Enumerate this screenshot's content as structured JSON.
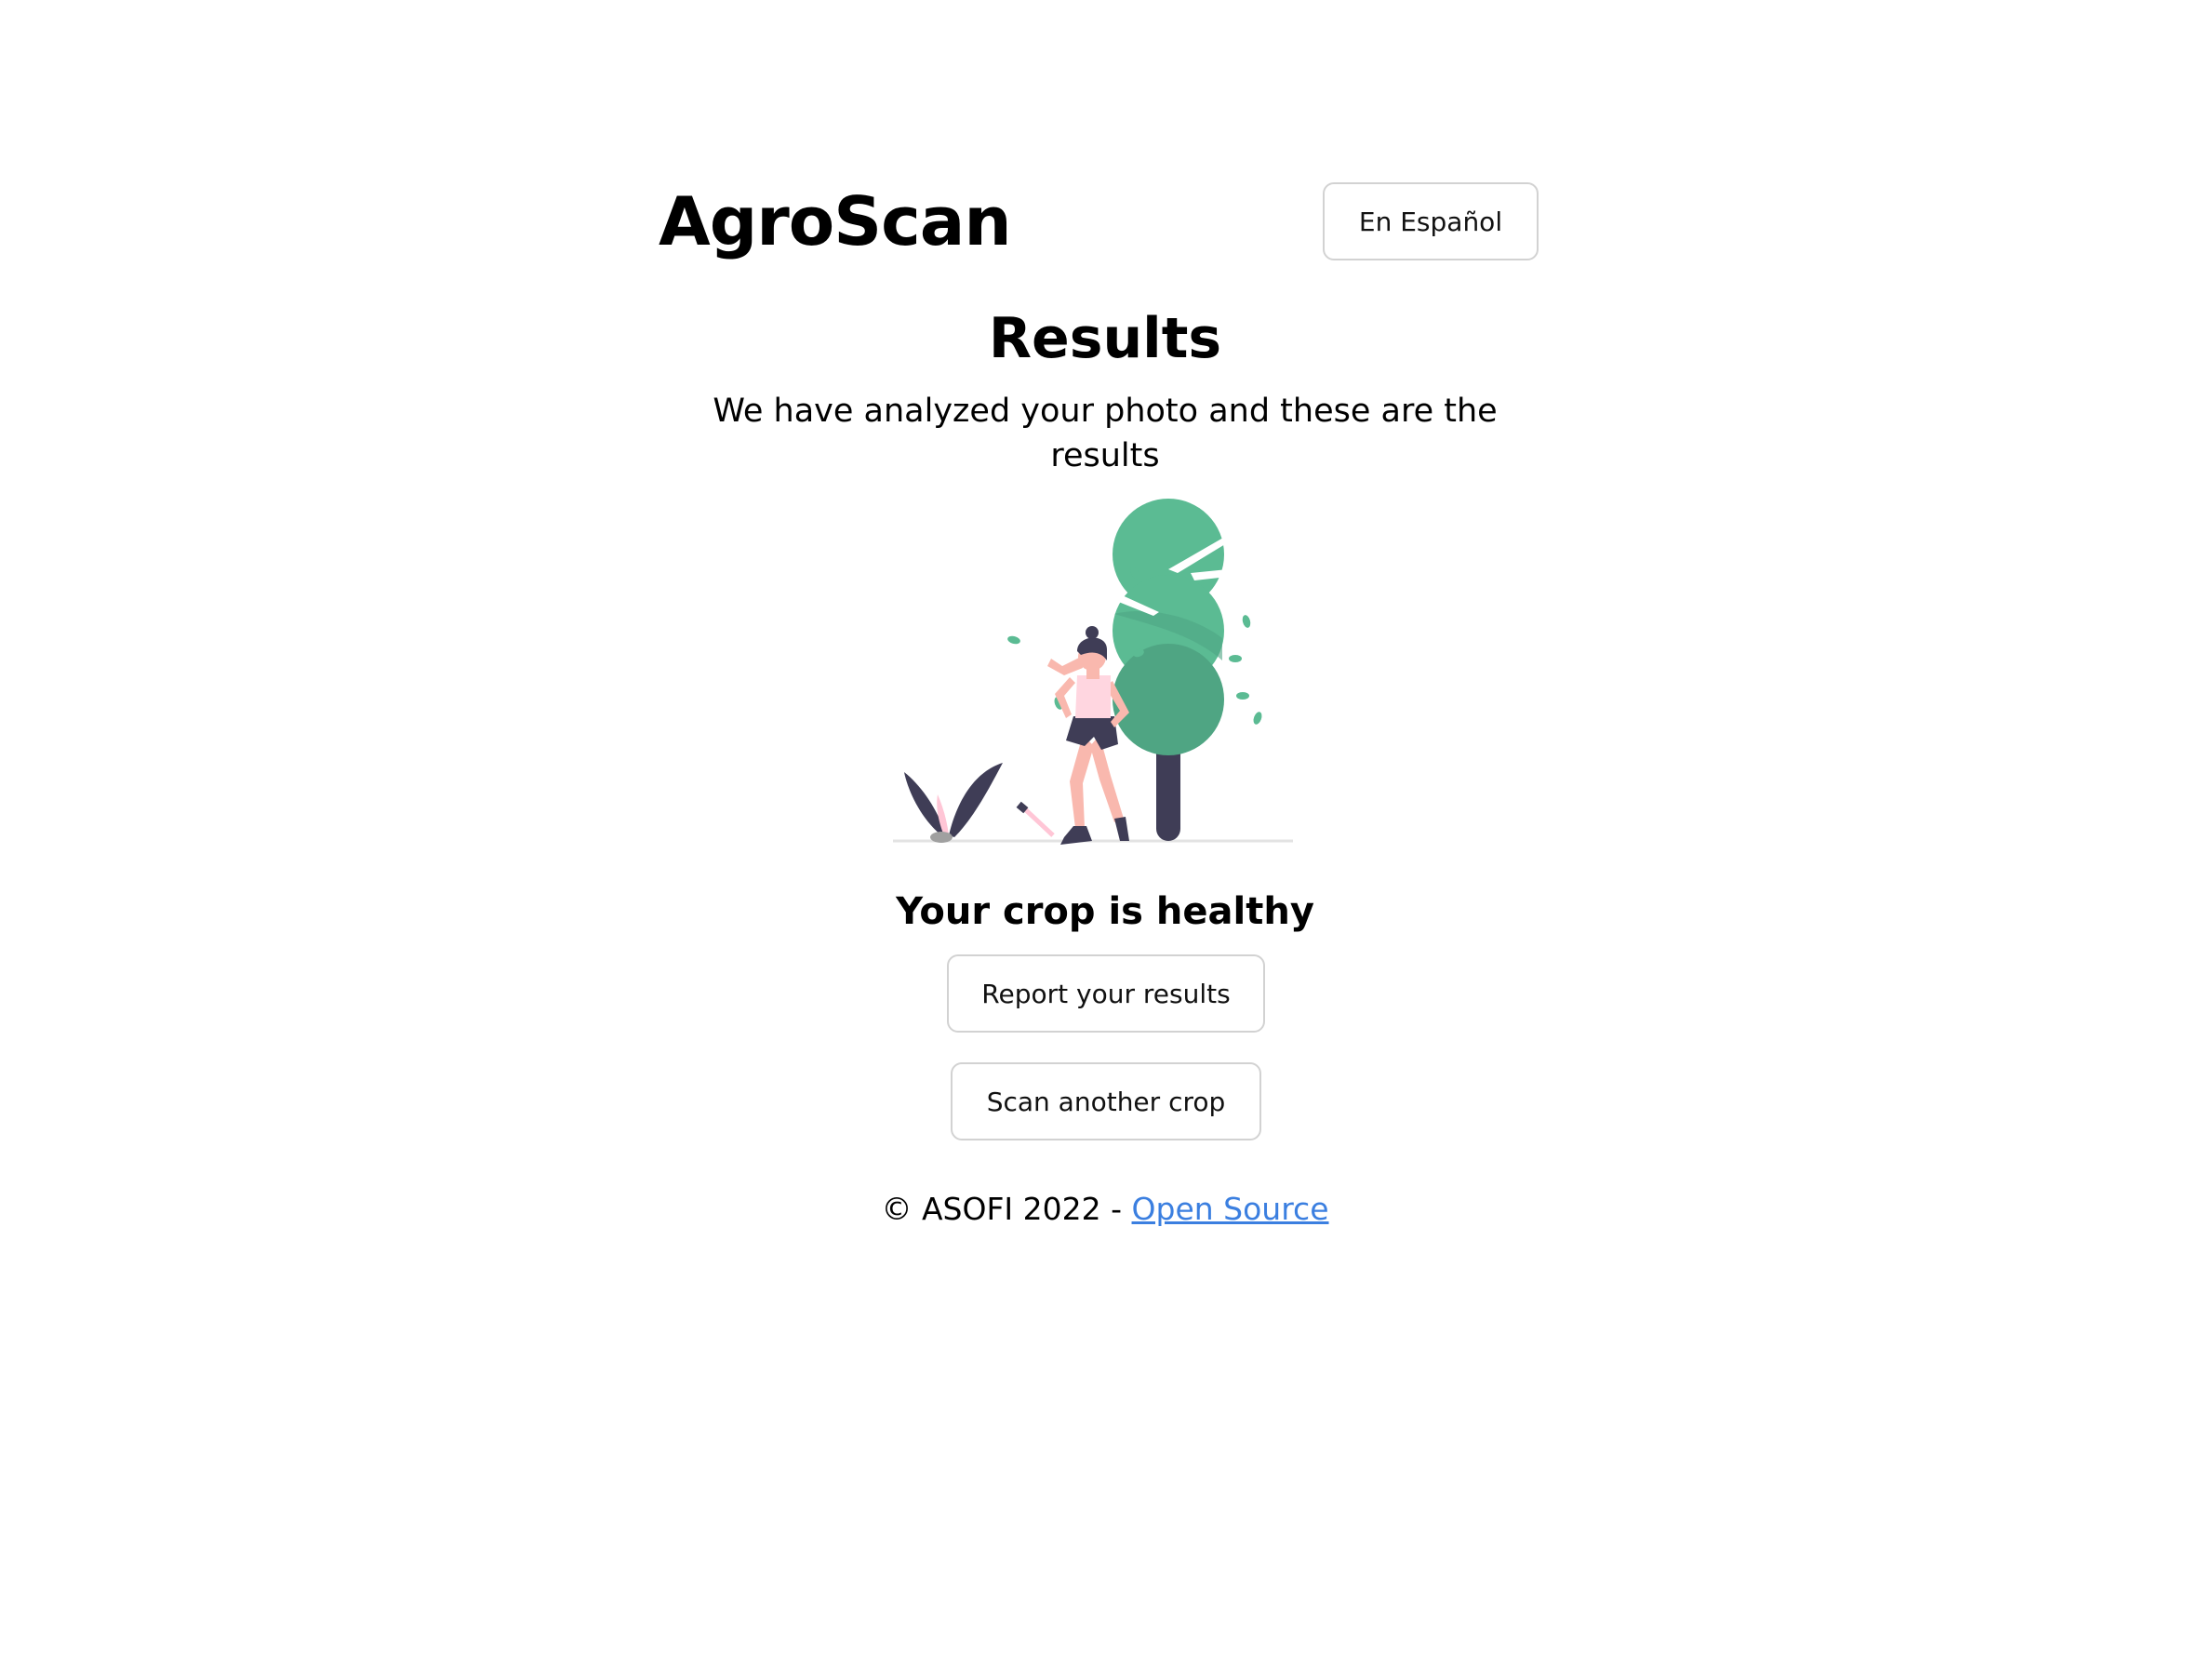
{
  "header": {
    "brand": "AgroScan",
    "language_button": "En Español"
  },
  "results": {
    "title": "Results",
    "subtitle": "We have analyzed your photo and these are the results",
    "status": "Your crop is healthy"
  },
  "actions": {
    "report_label": "Report your results",
    "scan_label": "Scan another crop"
  },
  "footer": {
    "copyright": "© ASOFI 2022 - ",
    "link_label": "Open Source"
  },
  "colors": {
    "tree_green": "#5bbb93",
    "tree_dark_green": "#4fa583",
    "trunk": "#3f3d56",
    "skin": "#f9b8ae",
    "top_pink": "#ffd6e0",
    "link_blue": "#3b7fe0"
  }
}
